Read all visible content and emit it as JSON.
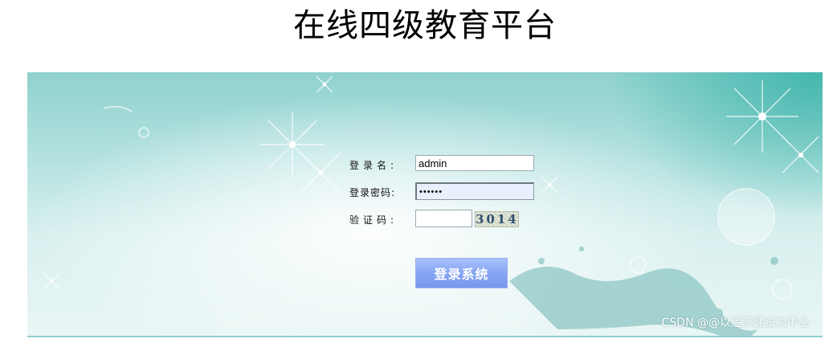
{
  "page": {
    "title": "在线四级教育平台"
  },
  "login_form": {
    "username_label": "登录名:",
    "username_value": "admin",
    "password_label": "登录密码:",
    "password_value": "••••••",
    "captcha_label": "验证码:",
    "captcha_value": "",
    "captcha_image_text": "3014",
    "submit_label": "登录系统"
  },
  "watermark": {
    "text": "CSDN @@以经济建设为中心"
  },
  "colors": {
    "panel_top": "#8fd2cf",
    "panel_bottom": "#e9f6f5",
    "button_bg": "#86a5f3",
    "button_text": "#ffffff"
  }
}
